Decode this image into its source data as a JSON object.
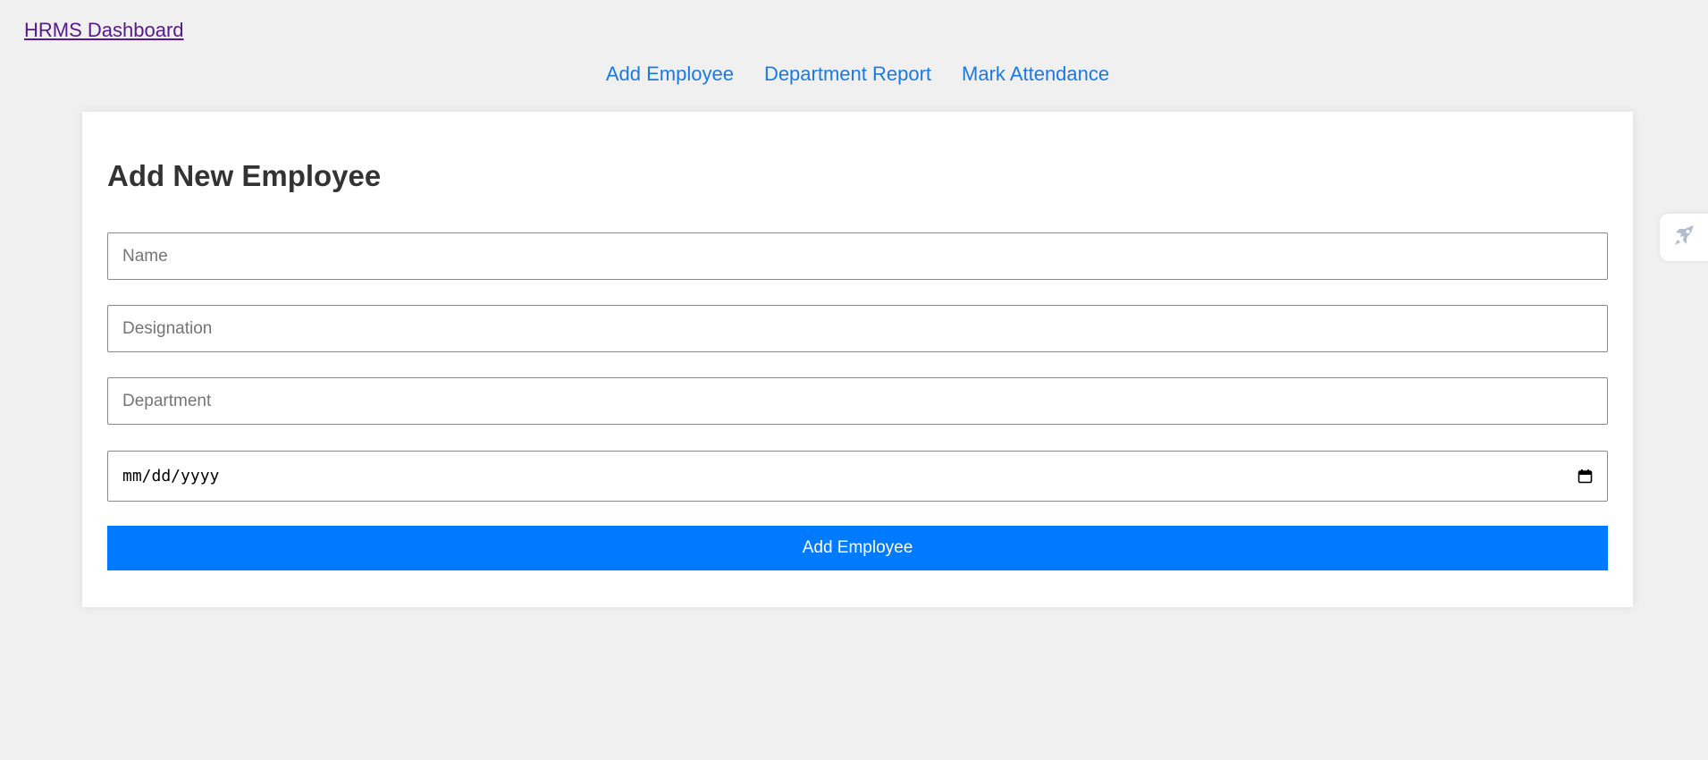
{
  "header": {
    "home_link": "HRMS Dashboard"
  },
  "nav": {
    "items": [
      {
        "label": "Add Employee"
      },
      {
        "label": "Department Report"
      },
      {
        "label": "Mark Attendance"
      }
    ]
  },
  "form": {
    "title": "Add New Employee",
    "name_placeholder": "Name",
    "designation_placeholder": "Designation",
    "department_placeholder": "Department",
    "date_placeholder": "mm/dd/yyyy",
    "submit_label": "Add Employee"
  },
  "icons": {
    "calendar": "calendar-icon",
    "side_widget": "rocket-icon"
  },
  "colors": {
    "accent": "#007bff",
    "link": "#1a7ae0",
    "visited_link": "#551a8b",
    "background": "#f0f0f0"
  }
}
